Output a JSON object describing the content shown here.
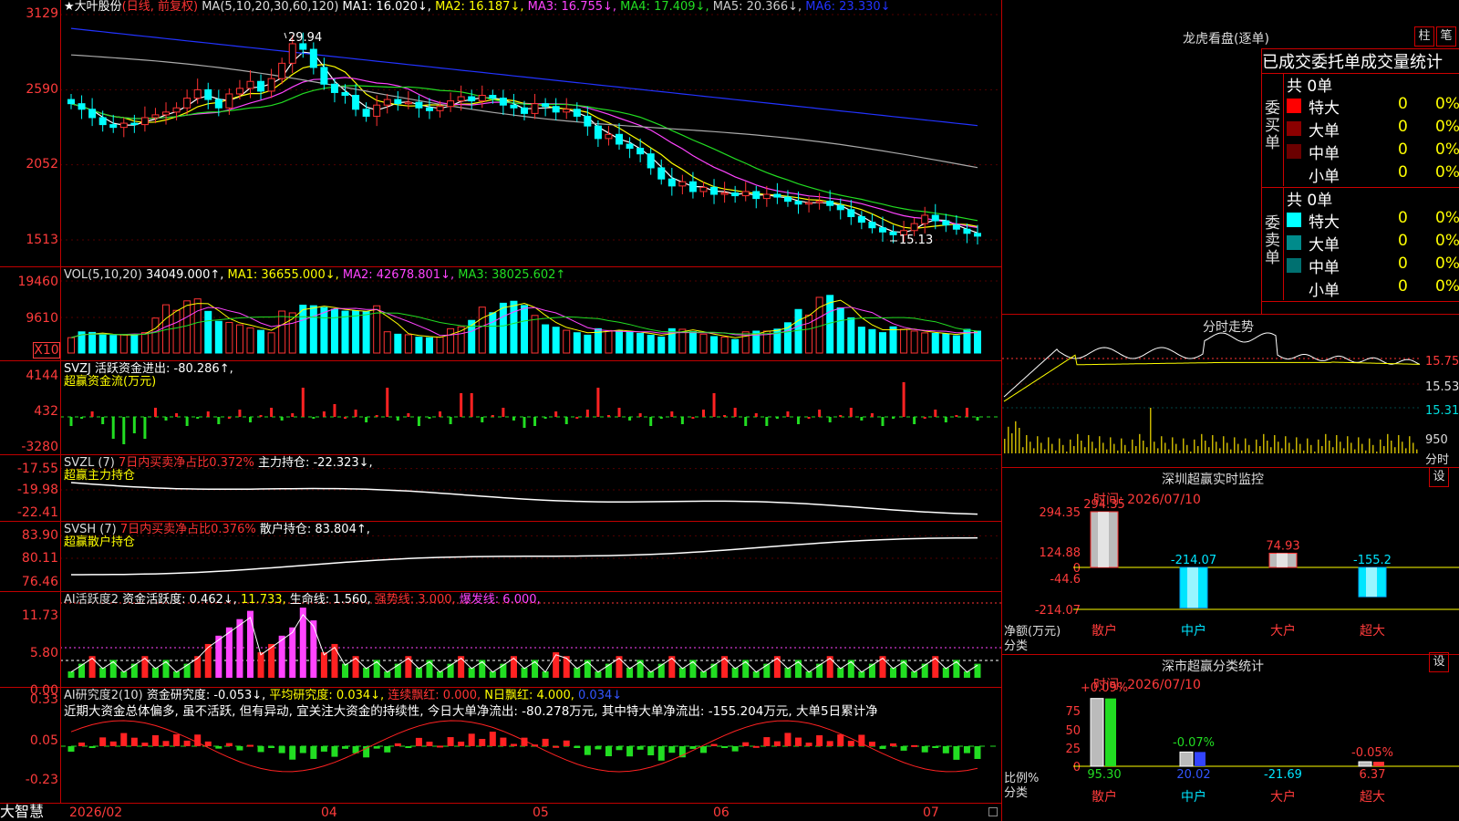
{
  "footer": {
    "app": "大智慧",
    "months": [
      "2026/02",
      "04",
      "05",
      "06",
      "07"
    ]
  },
  "panels": {
    "main": {
      "title": "★大叶股份",
      "tag": "(日线, 前复权)",
      "ma": "MA(5,10,20,30,60,120)",
      "items": [
        {
          "t": "MA1: 16.020↓,",
          "c": "#ffffff"
        },
        {
          "t": "MA2: 16.187↓,",
          "c": "#ffff00"
        },
        {
          "t": "MA3: 16.755↓,",
          "c": "#ff44ff"
        },
        {
          "t": "MA4: 17.409↓,",
          "c": "#22dd22"
        },
        {
          "t": "MA5: 20.366↓,",
          "c": "#cccccc"
        },
        {
          "t": "MA6: 23.330↓",
          "c": "#2233ff"
        }
      ],
      "yticks": [
        "3129",
        "2590",
        "2052",
        "1513"
      ],
      "high": "29.94",
      "low": "15.13"
    },
    "vol": {
      "items": [
        {
          "t": "VOL(5,10,20)",
          "c": "#dddddd"
        },
        {
          "t": "34049.000↑,",
          "c": "#ffffff"
        },
        {
          "t": "MA1: 36655.000↓,",
          "c": "#ffff00"
        },
        {
          "t": "MA2: 42678.801↓,",
          "c": "#ff44ff"
        },
        {
          "t": "MA3: 38025.602↑",
          "c": "#22dd22"
        }
      ],
      "yticks": [
        "19460",
        "9610",
        "X10"
      ]
    },
    "svzj": {
      "items": [
        {
          "t": "SVZJ  活跃资金进出: -80.286↑,",
          "c": "#ffffff"
        }
      ],
      "sub": "超赢资金流(万元)",
      "yticks": [
        "4144",
        "432",
        "-3280"
      ]
    },
    "svzl": {
      "items": [
        {
          "t": "SVZL (7)",
          "c": "#dddddd"
        },
        {
          "t": "7日内买卖净占比0.372%",
          "c": "#ff3333"
        },
        {
          "t": "主力持仓: -22.323↓,",
          "c": "#ffffff"
        }
      ],
      "sub": "超赢主力持仓",
      "yticks": [
        "-17.55",
        "-19.98",
        "-22.41"
      ]
    },
    "svsh": {
      "items": [
        {
          "t": "SVSH (7)",
          "c": "#dddddd"
        },
        {
          "t": "7日内买卖净占比0.376%",
          "c": "#ff3333"
        },
        {
          "t": "散户持仓: 83.804↑,",
          "c": "#ffffff"
        }
      ],
      "sub": "超赢散户持仓",
      "yticks": [
        "83.90",
        "80.11",
        "76.46"
      ]
    },
    "ai1": {
      "items": [
        {
          "t": "AI活跃度2",
          "c": "#dddddd"
        },
        {
          "t": "资金活跃度: 0.462↓,",
          "c": "#ffffff"
        },
        {
          "t": "11.733,",
          "c": "#ffff00"
        },
        {
          "t": "生命线: 1.560,",
          "c": "#ffffff"
        },
        {
          "t": "强势线: 3.000,",
          "c": "#ff3333"
        },
        {
          "t": "爆发线: 6.000,",
          "c": "#ff44ff"
        }
      ],
      "yticks": [
        "11.73",
        "5.80",
        "0.00"
      ]
    },
    "ai2": {
      "items": [
        {
          "t": "AI研究度2(10)",
          "c": "#dddddd"
        },
        {
          "t": "资金研究度: -0.053↓,",
          "c": "#ffffff"
        },
        {
          "t": "平均研究度: 0.034↓,",
          "c": "#ffff00"
        },
        {
          "t": "连续飘红: 0.000,",
          "c": "#ff3333"
        },
        {
          "t": "N日飘红: 4.000,",
          "c": "#ffff00"
        },
        {
          "t": "0.034↓",
          "c": "#3355ff"
        }
      ],
      "text": "近期大资金总体偏多, 虽不活跃, 但有异动, 宜关注大资金的持续性, 今日大单净流出: -80.278万元, 其中特大单净流出: -155.204万元, 大单5日累计净",
      "yticks": [
        "0.33",
        "0.05",
        "-0.23"
      ]
    }
  },
  "right": {
    "dragon": {
      "title": "龙虎看盘(逐单)",
      "btn1": "柱",
      "btn2": "笔",
      "header": "已成交委托单成交量统计",
      "buy": {
        "side": "委买单",
        "count": "共 0单",
        "rows": [
          {
            "name": "特大",
            "val": "0",
            "pct": "0%",
            "color": "#ff0000"
          },
          {
            "name": "大单",
            "val": "0",
            "pct": "0%",
            "color": "#8b0000"
          },
          {
            "name": "中单",
            "val": "0",
            "pct": "0%",
            "color": "#6b0000"
          },
          {
            "name": "小单",
            "val": "0",
            "pct": "0%",
            "color": ""
          }
        ]
      },
      "sell": {
        "side": "委卖单",
        "count": "共 0单",
        "rows": [
          {
            "name": "特大",
            "val": "0",
            "pct": "0%",
            "color": "#00ffff"
          },
          {
            "name": "大单",
            "val": "0",
            "pct": "0%",
            "color": "#008b8b"
          },
          {
            "name": "中单",
            "val": "0",
            "pct": "0%",
            "color": "#007070"
          },
          {
            "name": "小单",
            "val": "0",
            "pct": "0%",
            "color": ""
          }
        ]
      }
    },
    "intraday": {
      "title": "分时走势",
      "yticks": [
        "15.75",
        "15.53",
        "15.31"
      ],
      "vol_tick": "950",
      "unit": "分时"
    },
    "sz_monitor": {
      "title": "深圳超赢实时监控",
      "btn": "设",
      "time": "时间: 2026/07/10",
      "ylabel1": "净额(万元)",
      "ylabel2": "分类",
      "yticks": [
        "294.35",
        "124.88",
        "0",
        "-44.6",
        "-214.07"
      ],
      "cats": [
        "散户",
        "中户",
        "大户",
        "超大"
      ],
      "labels": [
        "294.35",
        "-214.07",
        "74.93",
        "-155.2"
      ],
      "bars": [
        294.35,
        -214.07,
        74.93,
        -155.2
      ]
    },
    "sz_class": {
      "title": "深市超赢分类统计",
      "btn": "设",
      "time": "时间: 2026/07/10",
      "ylabel1": "比例%",
      "ylabel2": "分类",
      "yticks": [
        "75",
        "50",
        "25",
        "0"
      ],
      "cats": [
        "散户",
        "中户",
        "大户",
        "超大"
      ],
      "top": [
        "+0.09%",
        "-0.07%",
        "-0.05%"
      ],
      "bottom": [
        "95.30",
        "20.02",
        "-21.69",
        "6.37"
      ]
    }
  },
  "chart_data": [
    {
      "type": "candlestick",
      "title": "大叶股份 日线",
      "y_ticks": [
        31.29,
        25.9,
        20.52,
        15.13
      ],
      "annotations": {
        "high": 29.94,
        "low": 15.13
      },
      "last": {
        "MA1": 16.02,
        "MA2": 16.187,
        "MA3": 16.755,
        "MA4": 17.409,
        "MA5": 20.366,
        "MA6": 23.33
      },
      "close": [
        24.9,
        24.5,
        23.9,
        23.4,
        23.2,
        23.5,
        23.4,
        23.9,
        24.1,
        24.3,
        24.6,
        25.3,
        25.9,
        25.2,
        24.6,
        25.6,
        26.0,
        26.5,
        25.8,
        26.7,
        27.8,
        29.2,
        28.8,
        27.5,
        26.3,
        25.7,
        25.5,
        24.5,
        24.0,
        24.8,
        25.2,
        24.9,
        25.0,
        24.6,
        24.4,
        24.7,
        25.1,
        25.4,
        25.1,
        25.5,
        25.3,
        24.8,
        24.6,
        24.2,
        24.9,
        24.7,
        24.3,
        24.5,
        24.0,
        23.3,
        22.4,
        22.7,
        22.0,
        21.7,
        21.3,
        20.3,
        19.5,
        19.0,
        19.3,
        18.6,
        18.9,
        18.4,
        18.5,
        18.3,
        18.6,
        18.1,
        18.4,
        18.2,
        17.9,
        17.7,
        17.8,
        17.9,
        17.6,
        17.3,
        16.8,
        16.4,
        16.0,
        15.7,
        15.5,
        15.8,
        16.3,
        16.9,
        16.5,
        16.2,
        15.9,
        15.6,
        15.4
      ]
    }
  ]
}
